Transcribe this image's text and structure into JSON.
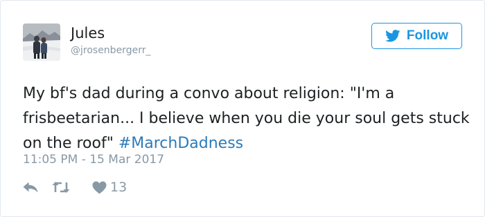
{
  "user": {
    "display_name": "Jules",
    "handle": "@jrosenbergerr_",
    "avatar_icon": "profile-photo-snowy-couple"
  },
  "follow_button": {
    "label": "Follow",
    "icon": "twitter-bird-icon",
    "color": "#1b95e0"
  },
  "tweet": {
    "text": "My bf's dad during a convo about religion: \"I'm a frisbeetarian... I believe when you die your soul gets stuck on the roof\" ",
    "hashtag": "#MarchDadness",
    "timestamp": "11:05 PM - 15 Mar 2017"
  },
  "actions": {
    "reply_icon": "reply-icon",
    "retweet_icon": "retweet-icon",
    "like_icon": "heart-icon",
    "like_count": "13"
  },
  "colors": {
    "text": "#1c2022",
    "muted": "#8899a6",
    "link": "#2b7bb9",
    "border": "#e1e8ed"
  }
}
